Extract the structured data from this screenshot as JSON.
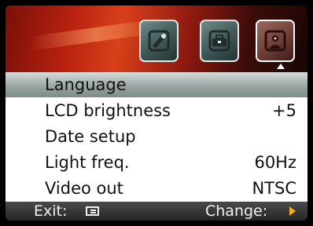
{
  "header": {
    "tabs": [
      {
        "icon": "camera-icon",
        "selected": false
      },
      {
        "icon": "toolbox-icon",
        "selected": false
      },
      {
        "icon": "settings-person-icon",
        "selected": true
      }
    ]
  },
  "menu": {
    "items": [
      {
        "label": "Language",
        "value": "",
        "selected": true
      },
      {
        "label": "LCD brightness",
        "value": "+5",
        "selected": false
      },
      {
        "label": "Date setup",
        "value": "",
        "selected": false
      },
      {
        "label": "Light freq.",
        "value": "60Hz",
        "selected": false
      },
      {
        "label": "Video out",
        "value": "NTSC",
        "selected": false
      }
    ]
  },
  "footer": {
    "exit_label": "Exit:",
    "exit_icon": "menu-button-icon",
    "change_label": "Change:",
    "change_icon": "right-arrow-icon",
    "arrow_color": "#f2b10f"
  }
}
